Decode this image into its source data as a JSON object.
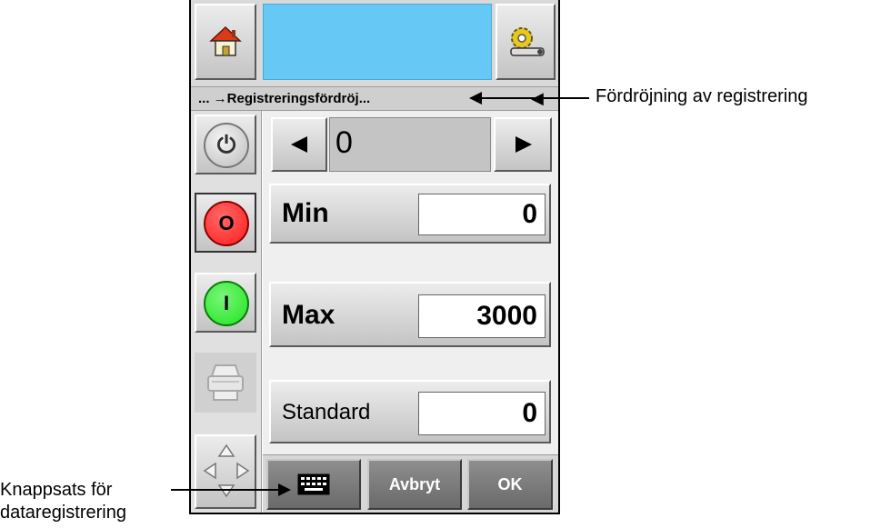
{
  "breadcrumb": {
    "text": "... →Registreringsfördröj..."
  },
  "stepper": {
    "value": "0"
  },
  "fields": {
    "min": {
      "label": "Min",
      "value": "0"
    },
    "max": {
      "label": "Max",
      "value": "3000"
    },
    "standard": {
      "label": "Standard",
      "value": "0"
    }
  },
  "sidebar": {
    "stop_label": "O",
    "start_label": "I"
  },
  "bottom_bar": {
    "cancel_label": "Avbryt",
    "ok_label": "OK"
  },
  "callouts": {
    "top_right": "Fördröjning av registrering",
    "bottom_left_line1": "Knappsats för",
    "bottom_left_line2": "dataregistrering"
  },
  "colors": {
    "status_box": "#66c9f5",
    "stop_button": "#ff1a1a",
    "start_button": "#1ee61e"
  },
  "icons": [
    "home-icon",
    "settings-gear-icon",
    "power-icon",
    "printer-icon",
    "navigation-arrows-icon",
    "keyboard-icon",
    "arrow-left-icon",
    "arrow-right-icon"
  ]
}
